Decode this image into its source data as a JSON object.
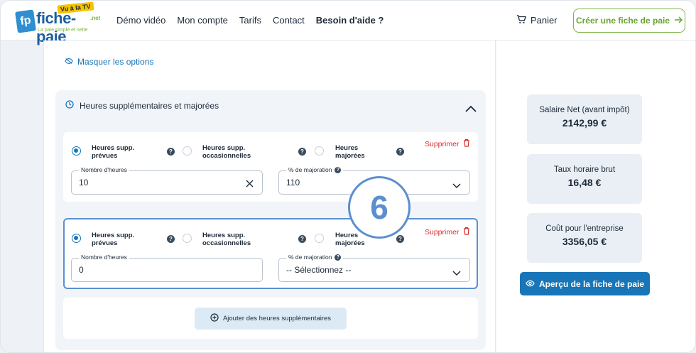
{
  "header": {
    "logo": {
      "name": "fiche-paie",
      "tv_badge": "Vu à la TV",
      "net": ".net",
      "tagline": "La paie simple et nette"
    },
    "nav": [
      "Démo vidéo",
      "Mon compte",
      "Tarifs",
      "Contact",
      "Besoin d'aide ?"
    ],
    "cart_label": "Panier",
    "cta_label": "Créer une fiche de paie"
  },
  "options": {
    "hide_label": "Masquer les options"
  },
  "section": {
    "title": "Heures supplémentaires et majorées",
    "rows": [
      {
        "opt1": [
          "Heures supp.",
          "prévues"
        ],
        "opt2": [
          "Heures supp.",
          "occasionnelles"
        ],
        "opt3": [
          "Heures",
          "majorées"
        ],
        "selected": 1,
        "delete_label": "Supprimer",
        "hours_label": "Nombre d'heures",
        "hours_value": "10",
        "rate_label": "% de majoration",
        "rate_value": "110"
      },
      {
        "opt1": [
          "Heures supp.",
          "prévues"
        ],
        "opt2": [
          "Heures supp.",
          "occasionnelles"
        ],
        "opt3": [
          "Heures",
          "majorées"
        ],
        "selected": 1,
        "delete_label": "Supprimer",
        "hours_label": "Nombre d'heures",
        "hours_value": "0",
        "rate_label": "% de majoration",
        "rate_value": "-- Sélectionnez --"
      }
    ],
    "add_label": "Ajouter des heures supplémentaires"
  },
  "step_number": "6",
  "summary": [
    {
      "label": "Salaire Net (avant impôt)",
      "value": "2142,99 €"
    },
    {
      "label": "Taux horaire brut",
      "value": "16,48 €"
    },
    {
      "label": "Coût pour l'entreprise",
      "value": "3356,05 €"
    }
  ],
  "preview_label": "Aperçu de la fiche de paie",
  "colors": {
    "primary": "#1775b8",
    "accent_green": "#7cb342",
    "danger": "#d32f2f",
    "highlight": "#5b8fcf"
  }
}
